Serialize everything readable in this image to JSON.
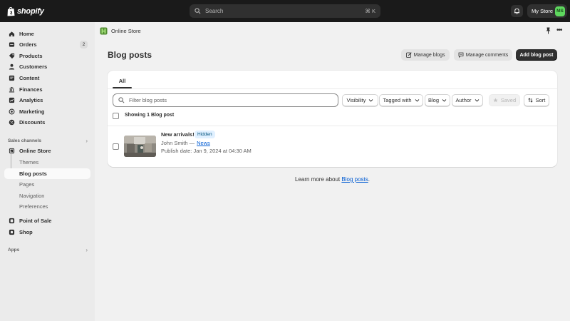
{
  "topbar": {
    "logo_text": "shopify",
    "search_placeholder": "Search",
    "search_shortcut": "⌘ K",
    "store_name": "My Store",
    "avatar_initials": "MS"
  },
  "sidebar": {
    "main_items": [
      {
        "label": "Home",
        "icon": "home-icon"
      },
      {
        "label": "Orders",
        "icon": "orders-icon",
        "badge": "2"
      },
      {
        "label": "Products",
        "icon": "tag-icon"
      },
      {
        "label": "Customers",
        "icon": "person-icon"
      },
      {
        "label": "Content",
        "icon": "content-icon"
      },
      {
        "label": "Finances",
        "icon": "bank-icon"
      },
      {
        "label": "Analytics",
        "icon": "chart-icon"
      },
      {
        "label": "Marketing",
        "icon": "target-icon"
      },
      {
        "label": "Discounts",
        "icon": "discount-icon"
      }
    ],
    "sales_channels_label": "Sales channels",
    "online_store_label": "Online Store",
    "sub_items": [
      "Themes",
      "Blog posts",
      "Pages",
      "Navigation",
      "Preferences"
    ],
    "active_sub_item": "Blog posts",
    "point_of_sale_label": "Point of Sale",
    "shop_label": "Shop",
    "apps_label": "Apps"
  },
  "breadcrumb": {
    "label": "Online Store"
  },
  "page": {
    "title": "Blog posts",
    "manage_blogs_label": "Manage blogs",
    "manage_comments_label": "Manage comments",
    "add_blog_post_label": "Add blog post"
  },
  "tabs": [
    {
      "label": "All",
      "selected": true
    }
  ],
  "filters": {
    "search_placeholder": "Filter blog posts",
    "visibility_label": "Visibility",
    "tagged_with_label": "Tagged with",
    "blog_label": "Blog",
    "author_label": "Author",
    "saved_label": "Saved",
    "sort_label": "Sort"
  },
  "list": {
    "showing_text": "Showing 1 Blog post",
    "posts": [
      {
        "title": "New arrivals!",
        "status": "Hidden",
        "author": "John Smith —",
        "blog": "News",
        "publish_date": "Publish date: Jan 9, 2024 at 04:30 AM"
      }
    ]
  },
  "footer": {
    "learn_prefix": "Learn more about",
    "learn_link": "Blog posts",
    "learn_suffix": "."
  },
  "colors": {
    "topbar_bg": "#1a1a1a",
    "sidebar_bg": "#ebebeb",
    "page_bg": "#f1f1f1",
    "primary_button": "#303030",
    "link": "#005bd3",
    "avatar": "#5ed75e",
    "hidden_badge_bg": "#e0f0ff"
  }
}
